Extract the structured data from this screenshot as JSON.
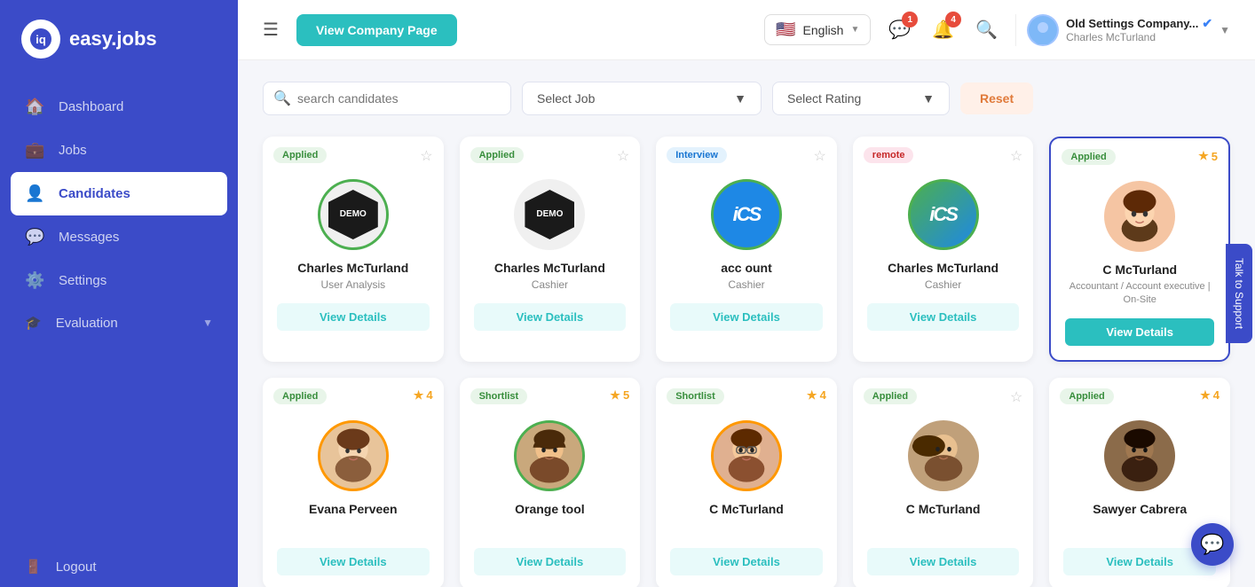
{
  "sidebar": {
    "logo_text": "easy.jobs",
    "items": [
      {
        "id": "dashboard",
        "label": "Dashboard",
        "icon": "🏠",
        "active": false
      },
      {
        "id": "jobs",
        "label": "Jobs",
        "icon": "💼",
        "active": false
      },
      {
        "id": "candidates",
        "label": "Candidates",
        "icon": "👤",
        "active": true
      },
      {
        "id": "messages",
        "label": "Messages",
        "icon": "💬",
        "active": false
      },
      {
        "id": "settings",
        "label": "Settings",
        "icon": "⚙️",
        "active": false
      },
      {
        "id": "evaluation",
        "label": "Evaluation",
        "icon": "🎓",
        "active": false
      }
    ],
    "logout_label": "Logout"
  },
  "header": {
    "view_company_btn": "View Company Page",
    "language": "English",
    "notifications_count_1": "1",
    "notifications_count_2": "4",
    "company_name": "Old Settings Company...",
    "user_name": "Charles McTurland",
    "search_placeholder": "search candidates"
  },
  "filters": {
    "select_job_label": "Select Job",
    "select_rating_label": "Select Rating",
    "reset_label": "Reset"
  },
  "candidates_row1": [
    {
      "tag": "Applied",
      "tag_class": "tag-applied",
      "name": "Charles McTurland",
      "job": "User Analysis",
      "avatar_type": "demo",
      "ring": "green",
      "btn_label": "View Details",
      "rated": false,
      "rating": null
    },
    {
      "tag": "Applied",
      "tag_class": "tag-applied",
      "name": "Charles McTurland",
      "job": "Cashier",
      "avatar_type": "demo",
      "ring": "none",
      "btn_label": "View Details",
      "rated": false,
      "rating": null
    },
    {
      "tag": "Interview",
      "tag_class": "tag-interview",
      "name": "acc ount",
      "job": "Cashier",
      "avatar_type": "ics_blue",
      "ring": "green",
      "btn_label": "View Details",
      "rated": false,
      "rating": null
    },
    {
      "tag": "remote",
      "tag_class": "tag-remote",
      "name": "Charles McTurland",
      "job": "Cashier",
      "avatar_type": "ics_gradient",
      "ring": "gradient",
      "btn_label": "View Details",
      "rated": false,
      "rating": null
    },
    {
      "tag": "Applied",
      "tag_class": "tag-applied",
      "name": "C McTurland",
      "job": "Accountant / Account executive | On-Site",
      "avatar_type": "person_brown",
      "ring": "none",
      "btn_label": "View Details",
      "active_btn": true,
      "rated": true,
      "rating": "5"
    }
  ],
  "candidates_row2": [
    {
      "tag": "Applied",
      "tag_class": "tag-applied",
      "name": "Evana Perveen",
      "job": "",
      "avatar_type": "person_tan",
      "ring": "orange",
      "btn_label": "View Details",
      "rated": true,
      "rating": "4"
    },
    {
      "tag": "Shortlist",
      "tag_class": "tag-shortlist",
      "name": "Orange tool",
      "job": "",
      "avatar_type": "person_photo1",
      "ring": "green",
      "btn_label": "View Details",
      "rated": true,
      "rating": "5"
    },
    {
      "tag": "Shortlist",
      "tag_class": "tag-shortlist",
      "name": "C McTurland",
      "job": "",
      "avatar_type": "person_glasses",
      "ring": "orange",
      "btn_label": "View Details",
      "rated": true,
      "rating": "4"
    },
    {
      "tag": "Applied",
      "tag_class": "tag-applied",
      "name": "C McTurland",
      "job": "",
      "avatar_type": "person_photo2",
      "ring": "none",
      "btn_label": "View Details",
      "rated": false,
      "rating": null
    },
    {
      "tag": "Applied",
      "tag_class": "tag-applied",
      "name": "Sawyer Cabrera",
      "job": "",
      "avatar_type": "person_dark",
      "ring": "none",
      "btn_label": "View Details",
      "rated": true,
      "rating": "4"
    }
  ],
  "talk_support": "Talk to Support",
  "chat_bubble_icon": "💬"
}
